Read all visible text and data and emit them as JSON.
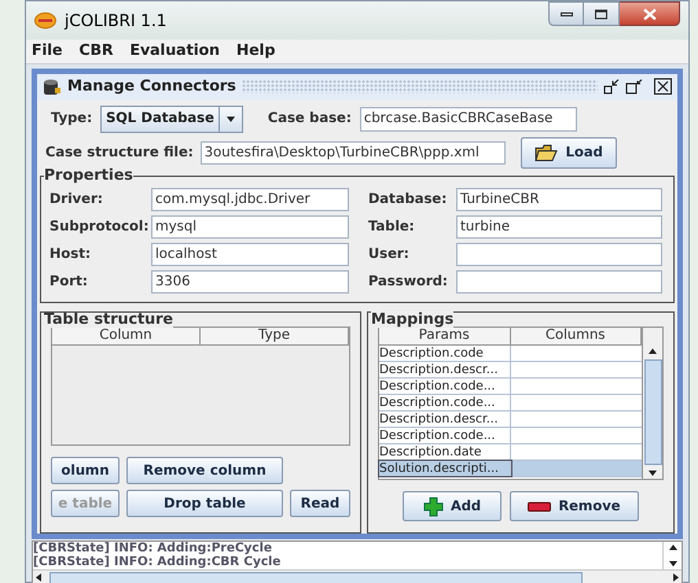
{
  "window": {
    "title": "jCOLIBRI 1.1"
  },
  "menu": [
    "File",
    "CBR",
    "Evaluation",
    "Help"
  ],
  "frame": {
    "title": "Manage Connectors"
  },
  "type": {
    "label": "Type:",
    "value": "SQL Database"
  },
  "case_base": {
    "label": "Case base:",
    "value": "cbrcase.BasicCBRCaseBase"
  },
  "case_structure": {
    "label": "Case structure file:",
    "value": "3outesfira\\Desktop\\TurbineCBR\\ppp.xml"
  },
  "load_button": "Load",
  "properties": {
    "title": "Properties",
    "fields": [
      {
        "label": "Driver:",
        "value": "com.mysql.jdbc.Driver"
      },
      {
        "label": "Database:",
        "value": "TurbineCBR"
      },
      {
        "label": "Subprotocol:",
        "value": "mysql"
      },
      {
        "label": "Table:",
        "value": "turbine"
      },
      {
        "label": "Host:",
        "value": "localhost"
      },
      {
        "label": "User:"
      },
      {
        "label": "Port:",
        "value": "3306"
      },
      {
        "label": "Password:"
      }
    ]
  },
  "table_structure": {
    "title": "Table structure",
    "columns": [
      "Column",
      "Type"
    ],
    "buttons": [
      {
        "label": "olumn",
        "disabled": false
      },
      {
        "label": "Remove column",
        "disabled": false
      },
      {
        "label": "e table",
        "disabled": true
      },
      {
        "label": "Drop table",
        "disabled": false
      },
      {
        "label": "Read",
        "disabled": false
      }
    ]
  },
  "mappings": {
    "title": "Mappings",
    "columns": [
      "Params",
      "Columns"
    ],
    "rows": [
      {
        "param": "Description.code",
        "selected": false
      },
      {
        "param": "Description.descr...",
        "selected": false
      },
      {
        "param": "Description.code...",
        "selected": false
      },
      {
        "param": "Description.code...",
        "selected": false
      },
      {
        "param": "Description.descr...",
        "selected": false
      },
      {
        "param": "Description.code...",
        "selected": false
      },
      {
        "param": "Description.date",
        "selected": false
      },
      {
        "param": "Solution.descripti...",
        "selected": true
      }
    ],
    "buttons": [
      {
        "label": "Add",
        "kind": "add"
      },
      {
        "label": "Remove",
        "kind": "remove"
      }
    ]
  },
  "log": [
    "[CBRState] INFO: Adding:PreCycle",
    "[CBRState] INFO: Adding:CBR Cycle"
  ]
}
